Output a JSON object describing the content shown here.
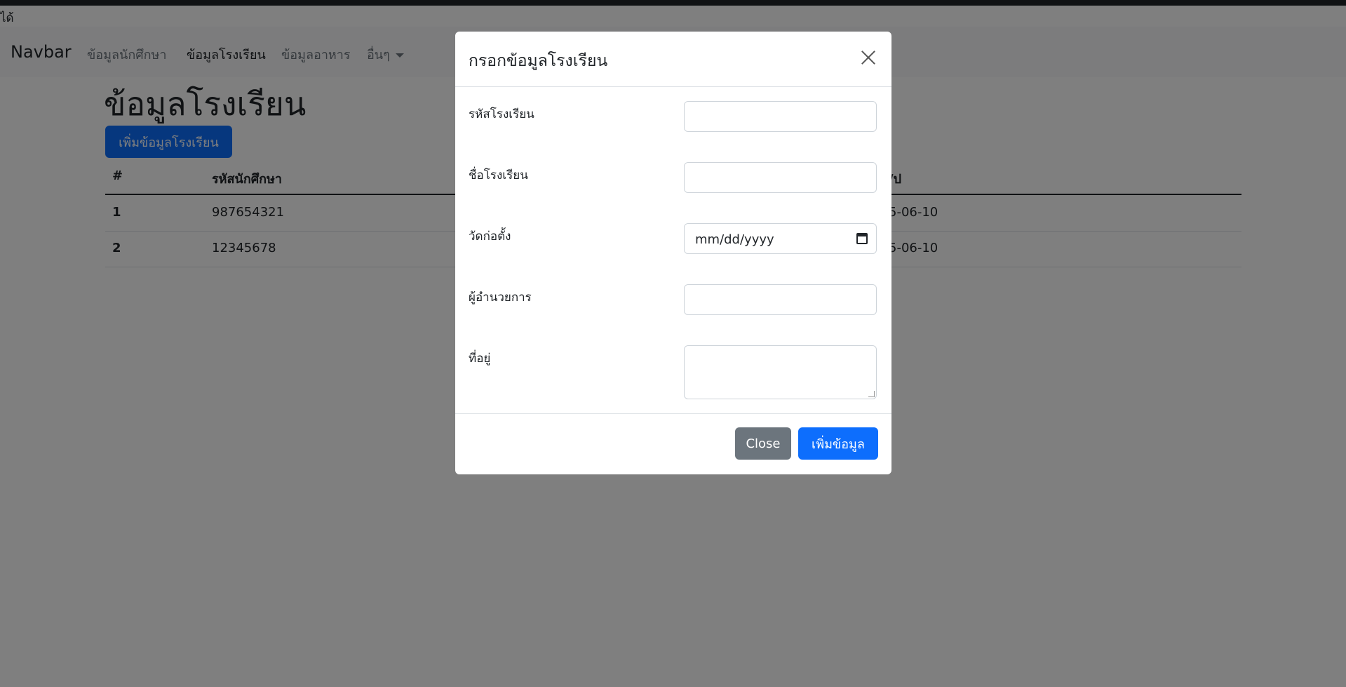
{
  "top_text": "ได้",
  "navbar": {
    "brand": "Navbar",
    "links": [
      "ข้อมูลนักศึกษา",
      "ข้อมูลโรงเรียน",
      "ข้อมูลอาหาร",
      "อื่นๆ"
    ]
  },
  "page": {
    "title": "ข้อมูลโรงเรียน",
    "add_button": "เพิ่มข้อมูลโรงเรียน"
  },
  "table": {
    "headers": [
      "#",
      "รหัสนักศึกษา",
      "/ป"
    ],
    "rows": [
      [
        "1",
        "987654321",
        "5-06-10"
      ],
      [
        "2",
        "12345678",
        "5-06-10"
      ]
    ]
  },
  "modal": {
    "title": "กรอกข้อมูลโรงเรียน",
    "fields": [
      {
        "label": "รหัสโรงเรียน",
        "value": ""
      },
      {
        "label": "ชื่อโรงเรียน",
        "value": ""
      },
      {
        "label": "วัดก่อตั้ง",
        "placeholder": "mm/dd/yyyy"
      },
      {
        "label": "ผู้อำนวยการ",
        "value": ""
      },
      {
        "label": "ที่อยู่",
        "value": ""
      }
    ],
    "close_button": "Close",
    "submit_button": "เพิ่มข้อมูล"
  },
  "colors": {
    "primary": "#0d6efd",
    "secondary": "#6c757d",
    "backdrop": "rgba(0,0,0,0.5)"
  }
}
